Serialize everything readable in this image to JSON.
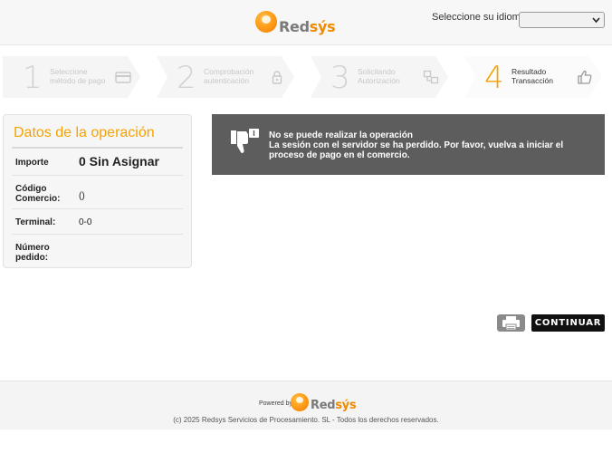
{
  "header": {
    "brand": {
      "part1": "Red",
      "part2": "sýs"
    },
    "language_label": "Seleccione su idioma",
    "language_value": ""
  },
  "steps": [
    {
      "number": "1",
      "label_line1": "Seleccione",
      "label_line2": "método de pago",
      "icon": "credit-card-icon",
      "active": false
    },
    {
      "number": "2",
      "label_line1": "Comprobación",
      "label_line2": "autenticación",
      "icon": "lock-icon",
      "active": false
    },
    {
      "number": "3",
      "label_line1": "Solicitando",
      "label_line2": "Autorización",
      "icon": "transfer-icon",
      "active": false
    },
    {
      "number": "4",
      "label_line1": "Resultado",
      "label_line2": "Transacción",
      "icon": "thumbs-up-icon",
      "active": true
    }
  ],
  "operation": {
    "title": "Datos de la operación",
    "amount_label": "Importe",
    "amount_value": "0 Sin Asignar",
    "merchant_label_line1": "Código",
    "merchant_label_line2": "Comercio:",
    "merchant_value": "()",
    "terminal_label": "Terminal:",
    "terminal_value": "0-0",
    "order_label_line1": "Número",
    "order_label_line2": "pedido:",
    "order_value": ""
  },
  "error": {
    "icon": "thumbs-down-icon",
    "title": "No se puede realizar la operación",
    "message": "La sesión con el servidor se ha perdido. Por favor, vuelva a iniciar el proceso de pago en el comercio."
  },
  "actions": {
    "print_icon": "printer-icon",
    "continue_label": "CONTINUAR"
  },
  "footer": {
    "powered_by": "Powered by",
    "brand": {
      "part1": "Red",
      "part2": "sýs"
    },
    "copyright": "(c) 2025 Redsys Servicios de Procesamiento. SL - Todos los derechos reservados."
  },
  "colors": {
    "accent": "#f5a300",
    "error_bg": "#5d5d5d",
    "button_bg": "#111111"
  }
}
